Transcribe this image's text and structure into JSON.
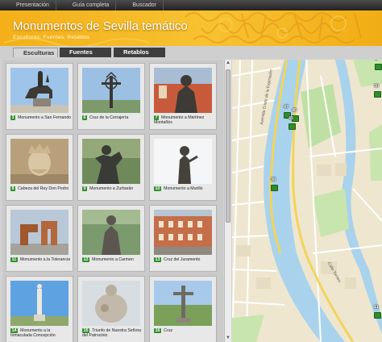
{
  "top_nav": [
    "Presentación",
    "Guía completa",
    "Buscador"
  ],
  "header": {
    "title": "Monumentos de Sevilla temático",
    "subtitle": "Esculturas, Fuentes, Retablos"
  },
  "tabs": [
    {
      "label": "Esculturas",
      "active": true
    },
    {
      "label": "Fuentes",
      "active": false
    },
    {
      "label": "Retablos",
      "active": false
    }
  ],
  "monuments": [
    {
      "num": "3",
      "caption": "Monumento a San Fernando",
      "thumb": "equestrian-statue"
    },
    {
      "num": "6",
      "caption": "Cruz de la Cerrajería",
      "thumb": "iron-cross"
    },
    {
      "num": "7",
      "caption": "Monumento a Martínez Montañés",
      "thumb": "bust-statue"
    },
    {
      "num": "8",
      "caption": "Cabeza del Rey Don Pedro",
      "thumb": "king-head"
    },
    {
      "num": "9",
      "caption": "Monumento a Zurbarán",
      "thumb": "bronze-figure"
    },
    {
      "num": "10",
      "caption": "Monumento a Murillo",
      "thumb": "painter-statue"
    },
    {
      "num": "11",
      "caption": "Monumento a la Tolerancia",
      "thumb": "abstract-sculpture"
    },
    {
      "num": "12",
      "caption": "Monumento a Carmen",
      "thumb": "woman-statue"
    },
    {
      "num": "13",
      "caption": "Cruz del Juramento",
      "thumb": "building-facade"
    },
    {
      "num": "14",
      "caption": "Monumento a la Inmaculada Concepción",
      "thumb": "column-monument"
    },
    {
      "num": "15",
      "caption": "Triunfo de Nuestra Señora del Patrocinio",
      "thumb": "marble-group"
    },
    {
      "num": "16",
      "caption": "Cruz",
      "thumb": "stone-cross"
    }
  ],
  "map": {
    "markers": [
      "47",
      "46",
      "45",
      "38",
      "30",
      "11",
      "1"
    ],
    "street_labels": [
      "Avenida Cristo de la Expiración",
      "Calle Torneo"
    ]
  }
}
